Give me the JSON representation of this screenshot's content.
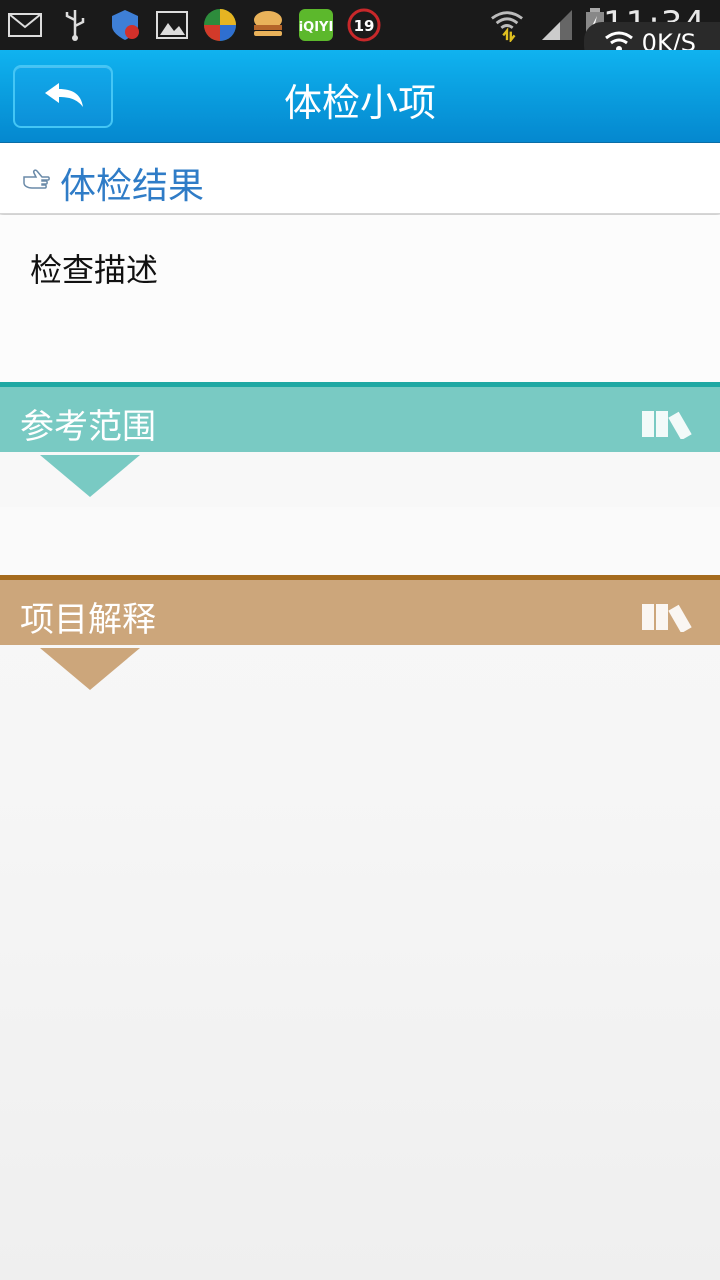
{
  "status_bar": {
    "time": "11:34",
    "network_speed": "0K/S",
    "icons": [
      "mail-icon",
      "usb-icon",
      "security-shield-icon",
      "gallery-icon",
      "browser-app-icon",
      "burger-app-icon",
      "iqiyi-app-icon",
      "notification-19-icon",
      "wifi-icon",
      "signal-icon",
      "battery-icon"
    ],
    "iqiyi_label": "iQIYI",
    "notification_count": "19"
  },
  "header": {
    "title": "体检小项"
  },
  "result": {
    "title": "体检结果",
    "description": "检查描述"
  },
  "sections": {
    "reference_range": {
      "label": "参考范围",
      "color": "#79cac3",
      "accent": "#1fa8a3"
    },
    "explanation": {
      "label": "项目解释",
      "color": "#cca67b",
      "accent": "#a56b1e"
    }
  },
  "colors": {
    "title_bar": "#0a9fe0",
    "result_title": "#2f7cc7"
  }
}
